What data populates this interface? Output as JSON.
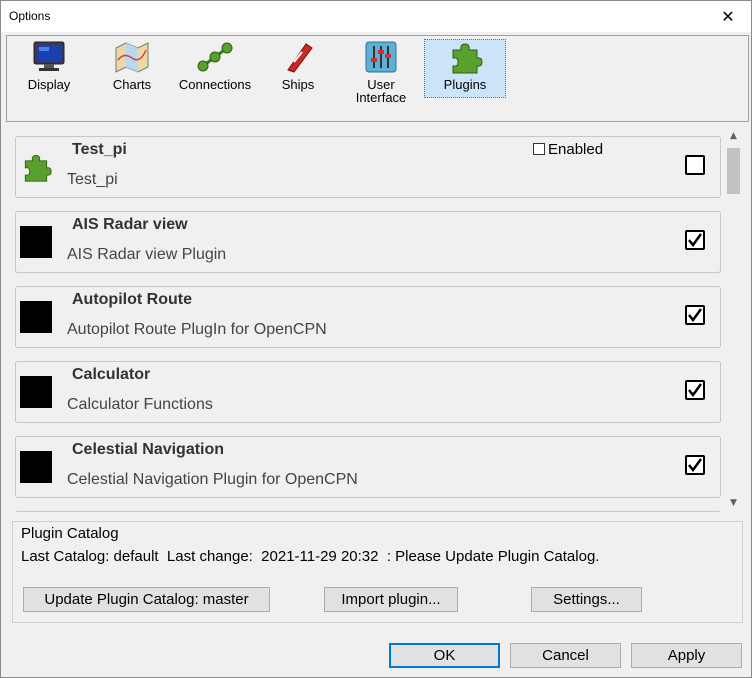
{
  "window": {
    "title": "Options",
    "close_glyph": "✕"
  },
  "toolbar": {
    "items": [
      {
        "label": "Display",
        "icon": "monitor-icon"
      },
      {
        "label": "Charts",
        "icon": "map-icon"
      },
      {
        "label": "Connections",
        "icon": "connections-icon"
      },
      {
        "label": "Ships",
        "icon": "ship-icon"
      },
      {
        "label_line1": "User",
        "label_line2": "Interface",
        "icon": "sliders-icon"
      },
      {
        "label": "Plugins",
        "icon": "puzzle-icon",
        "selected": true
      }
    ]
  },
  "plugins": {
    "enabled_label": "Enabled",
    "items": [
      {
        "name": "Test_pi",
        "description": "Test_pi",
        "checked": false
      },
      {
        "name": "AIS Radar view",
        "description": "AIS Radar view Plugin",
        "checked": true
      },
      {
        "name": "Autopilot Route",
        "description": "Autopilot Route PlugIn for OpenCPN",
        "checked": true
      },
      {
        "name": "Calculator",
        "description": "Calculator Functions",
        "checked": true
      },
      {
        "name": "Celestial Navigation",
        "description": "Celestial Navigation Plugin for OpenCPN",
        "checked": true
      }
    ]
  },
  "catalog": {
    "title": "Plugin Catalog",
    "info": "Last Catalog: default  Last change:  2021-11-29 20:32  : Please Update Plugin Catalog.",
    "update_button": "Update Plugin Catalog: master",
    "import_button": "Import plugin...",
    "settings_button": "Settings..."
  },
  "dialog_buttons": {
    "ok": "OK",
    "cancel": "Cancel",
    "apply": "Apply"
  },
  "colors": {
    "selected_bg": "#cce4f7",
    "puzzle_green": "#5aa02c",
    "default_button_border": "#0078d7"
  }
}
